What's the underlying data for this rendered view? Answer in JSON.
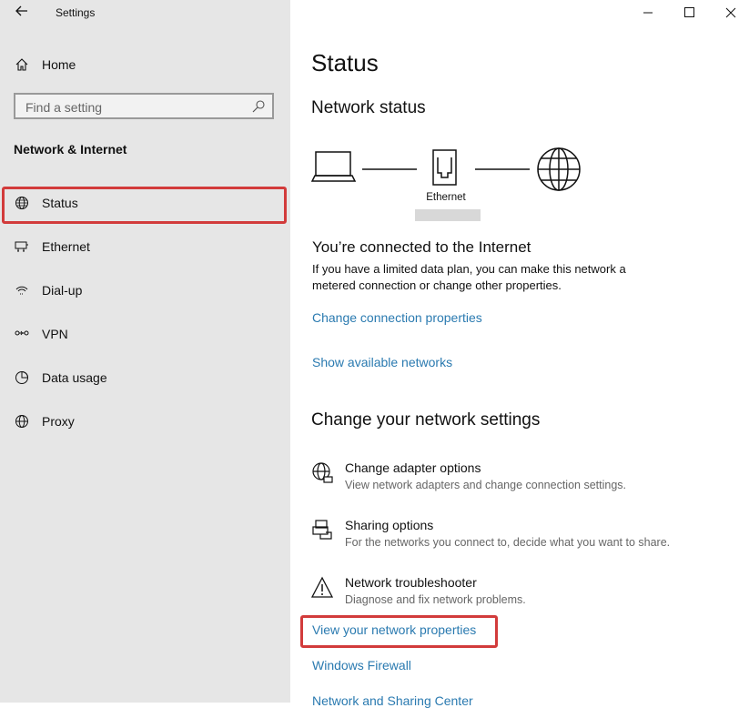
{
  "window": {
    "title": "Settings"
  },
  "sidebar": {
    "home_label": "Home",
    "search_placeholder": "Find a setting",
    "section_title": "Network & Internet",
    "items": [
      {
        "label": "Status",
        "icon": "status-globe-icon",
        "selected": true
      },
      {
        "label": "Ethernet",
        "icon": "ethernet-icon"
      },
      {
        "label": "Dial-up",
        "icon": "dialup-icon"
      },
      {
        "label": "VPN",
        "icon": "vpn-icon"
      },
      {
        "label": "Data usage",
        "icon": "data-usage-icon"
      },
      {
        "label": "Proxy",
        "icon": "proxy-globe-icon"
      }
    ]
  },
  "main": {
    "page_title": "Status",
    "network_status_heading": "Network status",
    "diagram": {
      "adapter_label": "Ethernet"
    },
    "connected_heading": "You’re connected to the Internet",
    "connected_desc_line1": "If you have a limited data plan, you can make this network a",
    "connected_desc_line2": "metered connection or change other properties.",
    "change_connection_link": "Change connection properties",
    "show_networks_link": "Show available networks",
    "change_settings_heading": "Change your network settings",
    "options": [
      {
        "title": "Change adapter options",
        "desc": "View network adapters and change connection settings.",
        "icon": "adapter-icon"
      },
      {
        "title": "Sharing options",
        "desc": "For the networks you connect to, decide what you want to share.",
        "icon": "sharing-icon"
      },
      {
        "title": "Network troubleshooter",
        "desc": "Diagnose and fix network problems.",
        "icon": "warning-icon"
      }
    ],
    "view_properties_link": "View your network properties",
    "firewall_link": "Windows Firewall",
    "sharing_center_link": "Network and Sharing Center"
  },
  "colors": {
    "sidebar_bg": "#e6e6e6",
    "link": "#2a7ab0",
    "highlight_border": "#d23b3b"
  }
}
